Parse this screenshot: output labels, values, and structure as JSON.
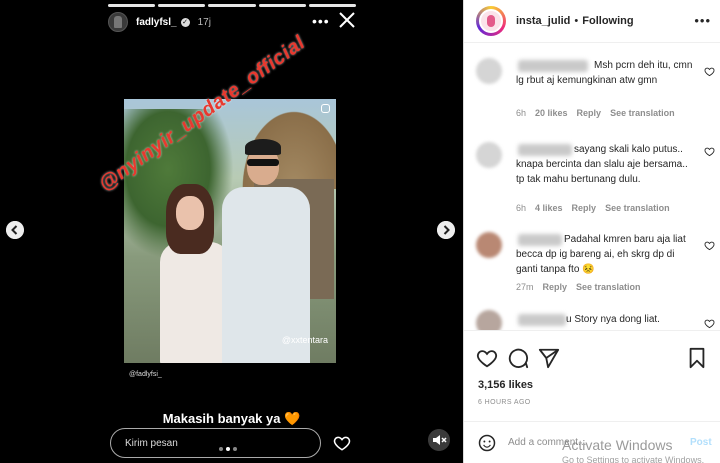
{
  "story": {
    "username": "fadlyfsl_",
    "verified_mark": "✓",
    "time": "17j",
    "more_label": "•••",
    "watermark": "@nyinyir_update_official",
    "photo_handle": "@xxtentara",
    "photo_tag": "@fadlyfsi_",
    "caption": "Makasih banyak ya",
    "caption_emoji": "🧡",
    "reply_placeholder": "Kirim pesan",
    "icons": [
      "close-icon",
      "more-icon",
      "chevron-left-icon",
      "chevron-right-icon",
      "heart-icon",
      "mute-icon"
    ]
  },
  "post": {
    "username": "insta_julid",
    "separator": "•",
    "follow_label": "Following",
    "more_label": "•••",
    "comments": [
      {
        "text": "Msh pcrn deh itu, cmn lg rbut aj kemungkinan atw gmn",
        "time": "6h",
        "likes": "20 likes",
        "reply": "Reply",
        "translate": "See translation"
      },
      {
        "text": "sayang skali kalo putus.. knapa bercinta dan slalu aje bersama.. tp tak mahu bertunang dulu.",
        "time": "6h",
        "likes": "4 likes",
        "reply": "Reply",
        "translate": "See translation"
      },
      {
        "text": "Padahal kmren baru aja liat becca dp ig bareng ai, eh skrg dp di ganti tanpa fto 😣",
        "time": "27m",
        "likes": "",
        "reply": "Reply",
        "translate": "See translation"
      },
      {
        "text": "u Story nya dong liat.",
        "time": "",
        "likes": "",
        "reply": "",
        "translate": ""
      }
    ],
    "likes_count": "3,156 likes",
    "posted_ago": "6 HOURS AGO",
    "add_comment_placeholder": "Add a comment...",
    "post_label": "Post"
  },
  "os_overlay": {
    "title": "Activate Windows",
    "subtitle": "Go to Settings to activate Windows."
  }
}
